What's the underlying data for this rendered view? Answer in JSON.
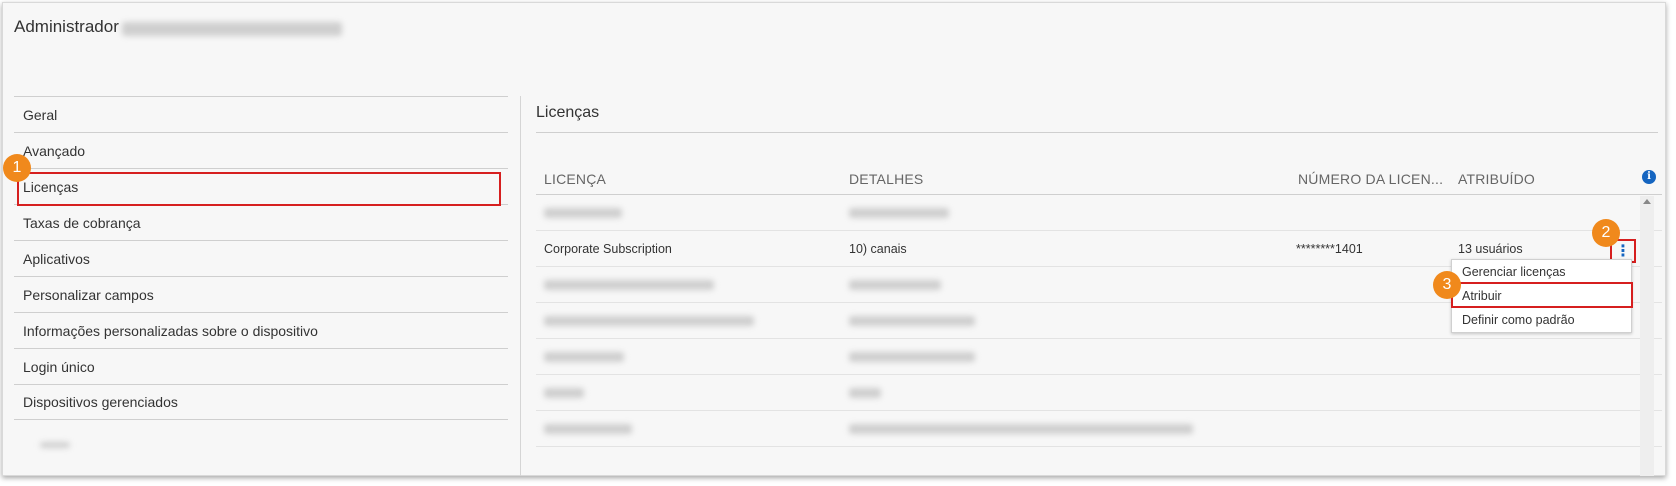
{
  "app": {
    "title": "Administrador"
  },
  "sidebar": {
    "items": [
      {
        "label": "Geral"
      },
      {
        "label": "Avançado"
      },
      {
        "label": "Licenças"
      },
      {
        "label": "Taxas de cobrança"
      },
      {
        "label": "Aplicativos"
      },
      {
        "label": "Personalizar campos"
      },
      {
        "label": "Informações personalizadas sobre o dispositivo"
      },
      {
        "label": "Login único"
      },
      {
        "label": "Dispositivos gerenciados"
      }
    ]
  },
  "main": {
    "title": "Licenças",
    "table": {
      "headers": [
        "LICENÇA",
        "DETALHES",
        "NÚMERO DA LICEN...",
        "ATRIBUÍDO"
      ],
      "visible_row": {
        "license": "Corporate Subscription",
        "details": "10) canais",
        "number": "********1401",
        "assigned": "13 usuários"
      }
    }
  },
  "context_menu": {
    "items": [
      "Gerenciar licenças",
      "Atribuir",
      "Definir como padrão"
    ]
  },
  "annotations": {
    "steps": [
      "1",
      "2",
      "3"
    ]
  },
  "icons": {
    "info": "info-icon",
    "more": "kebab-menu-icon",
    "scroll": "scroll-up-icon"
  },
  "colors": {
    "highlight": "#d61f1f",
    "badge": "#f0891c",
    "accent": "#1565c0"
  }
}
